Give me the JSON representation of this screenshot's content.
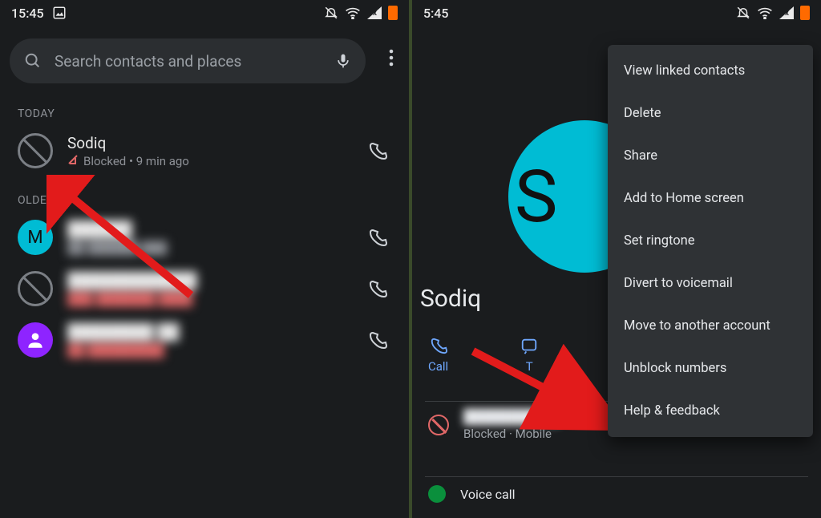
{
  "left": {
    "status": {
      "time": "15:45"
    },
    "search": {
      "placeholder": "Search contacts and places"
    },
    "sections": {
      "today_label": "TODAY",
      "older_label": "OLDER"
    },
    "calls": {
      "today": [
        {
          "name": "Sodiq",
          "sub": "Blocked • 9 min ago"
        }
      ],
      "older": [
        {
          "avatar_letter": "M",
          "name": "██████",
          "sub": "██ ██████ ███"
        },
        {
          "name": "████████████",
          "sub": "███ ███████ ████"
        },
        {
          "name": "████████ ██",
          "sub": "██ █████████"
        }
      ]
    }
  },
  "right": {
    "status": {
      "time_suffix": "5:45"
    },
    "contact": {
      "avatar_letter": "S",
      "name": "Sodiq",
      "actions": {
        "call": "Call",
        "text": "T"
      },
      "detail": {
        "number": "██████████",
        "sub": "Blocked · Mobile"
      },
      "voice": "Voice call"
    },
    "menu": {
      "items": [
        "View linked contacts",
        "Delete",
        "Share",
        "Add to Home screen",
        "Set ringtone",
        "Divert to voicemail",
        "Move to another account",
        "Unblock numbers",
        "Help & feedback"
      ]
    }
  }
}
